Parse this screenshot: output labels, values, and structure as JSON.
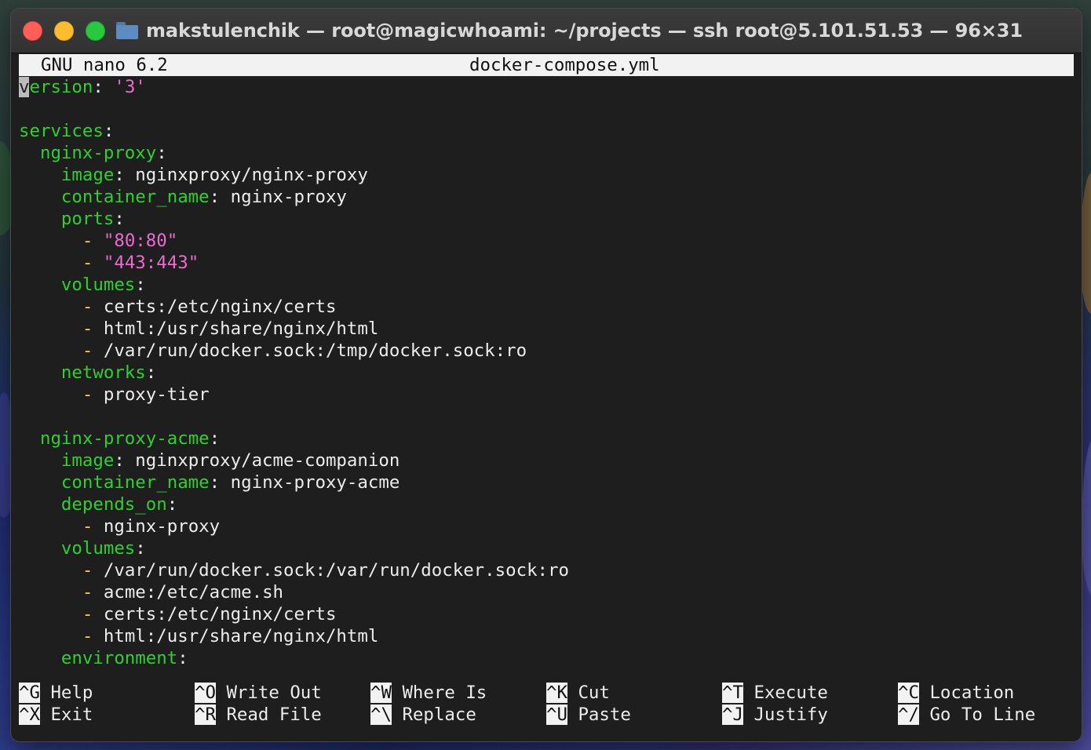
{
  "window": {
    "title": "makstulenchik — root@magicwhoami: ~/projects — ssh root@5.101.51.53 — 96×31"
  },
  "editor": {
    "app_version": "GNU nano 6.2",
    "filename": "docker-compose.yml"
  },
  "yaml_lines": [
    [
      {
        "t": "cursor",
        "v": "v"
      },
      {
        "t": "key",
        "v": "ersion"
      },
      {
        "t": "punct",
        "v": ": "
      },
      {
        "t": "str",
        "v": "'3'"
      }
    ],
    [],
    [
      {
        "t": "key",
        "v": "services"
      },
      {
        "t": "punct",
        "v": ":"
      }
    ],
    [
      {
        "t": "sp",
        "v": "  "
      },
      {
        "t": "key",
        "v": "nginx-proxy"
      },
      {
        "t": "punct",
        "v": ":"
      }
    ],
    [
      {
        "t": "sp",
        "v": "    "
      },
      {
        "t": "key",
        "v": "image"
      },
      {
        "t": "punct",
        "v": ": "
      },
      {
        "t": "val",
        "v": "nginxproxy/nginx-proxy"
      }
    ],
    [
      {
        "t": "sp",
        "v": "    "
      },
      {
        "t": "key",
        "v": "container_name"
      },
      {
        "t": "punct",
        "v": ": "
      },
      {
        "t": "val",
        "v": "nginx-proxy"
      }
    ],
    [
      {
        "t": "sp",
        "v": "    "
      },
      {
        "t": "key",
        "v": "ports"
      },
      {
        "t": "punct",
        "v": ":"
      }
    ],
    [
      {
        "t": "sp",
        "v": "      "
      },
      {
        "t": "dash",
        "v": "- "
      },
      {
        "t": "str",
        "v": "\"80:80\""
      }
    ],
    [
      {
        "t": "sp",
        "v": "      "
      },
      {
        "t": "dash",
        "v": "- "
      },
      {
        "t": "str",
        "v": "\"443:443\""
      }
    ],
    [
      {
        "t": "sp",
        "v": "    "
      },
      {
        "t": "key",
        "v": "volumes"
      },
      {
        "t": "punct",
        "v": ":"
      }
    ],
    [
      {
        "t": "sp",
        "v": "      "
      },
      {
        "t": "dash",
        "v": "- "
      },
      {
        "t": "val",
        "v": "certs:/etc/nginx/certs"
      }
    ],
    [
      {
        "t": "sp",
        "v": "      "
      },
      {
        "t": "dash",
        "v": "- "
      },
      {
        "t": "val",
        "v": "html:/usr/share/nginx/html"
      }
    ],
    [
      {
        "t": "sp",
        "v": "      "
      },
      {
        "t": "dash",
        "v": "- "
      },
      {
        "t": "val",
        "v": "/var/run/docker.sock:/tmp/docker.sock:ro"
      }
    ],
    [
      {
        "t": "sp",
        "v": "    "
      },
      {
        "t": "key",
        "v": "networks"
      },
      {
        "t": "punct",
        "v": ":"
      }
    ],
    [
      {
        "t": "sp",
        "v": "      "
      },
      {
        "t": "dash",
        "v": "- "
      },
      {
        "t": "val",
        "v": "proxy-tier"
      }
    ],
    [],
    [
      {
        "t": "sp",
        "v": "  "
      },
      {
        "t": "key",
        "v": "nginx-proxy-acme"
      },
      {
        "t": "punct",
        "v": ":"
      }
    ],
    [
      {
        "t": "sp",
        "v": "    "
      },
      {
        "t": "key",
        "v": "image"
      },
      {
        "t": "punct",
        "v": ": "
      },
      {
        "t": "val",
        "v": "nginxproxy/acme-companion"
      }
    ],
    [
      {
        "t": "sp",
        "v": "    "
      },
      {
        "t": "key",
        "v": "container_name"
      },
      {
        "t": "punct",
        "v": ": "
      },
      {
        "t": "val",
        "v": "nginx-proxy-acme"
      }
    ],
    [
      {
        "t": "sp",
        "v": "    "
      },
      {
        "t": "key",
        "v": "depends_on"
      },
      {
        "t": "punct",
        "v": ":"
      }
    ],
    [
      {
        "t": "sp",
        "v": "      "
      },
      {
        "t": "dash",
        "v": "- "
      },
      {
        "t": "val",
        "v": "nginx-proxy"
      }
    ],
    [
      {
        "t": "sp",
        "v": "    "
      },
      {
        "t": "key",
        "v": "volumes"
      },
      {
        "t": "punct",
        "v": ":"
      }
    ],
    [
      {
        "t": "sp",
        "v": "      "
      },
      {
        "t": "dash",
        "v": "- "
      },
      {
        "t": "val",
        "v": "/var/run/docker.sock:/var/run/docker.sock:ro"
      }
    ],
    [
      {
        "t": "sp",
        "v": "      "
      },
      {
        "t": "dash",
        "v": "- "
      },
      {
        "t": "val",
        "v": "acme:/etc/acme.sh"
      }
    ],
    [
      {
        "t": "sp",
        "v": "      "
      },
      {
        "t": "dash",
        "v": "- "
      },
      {
        "t": "val",
        "v": "certs:/etc/nginx/certs"
      }
    ],
    [
      {
        "t": "sp",
        "v": "      "
      },
      {
        "t": "dash",
        "v": "- "
      },
      {
        "t": "val",
        "v": "html:/usr/share/nginx/html"
      }
    ],
    [
      {
        "t": "sp",
        "v": "    "
      },
      {
        "t": "key",
        "v": "environment"
      },
      {
        "t": "punct",
        "v": ":"
      }
    ]
  ],
  "shortcuts": [
    [
      {
        "key": "^G",
        "label": "Help"
      },
      {
        "key": "^O",
        "label": "Write Out"
      },
      {
        "key": "^W",
        "label": "Where Is"
      },
      {
        "key": "^K",
        "label": "Cut"
      },
      {
        "key": "^T",
        "label": "Execute"
      },
      {
        "key": "^C",
        "label": "Location"
      }
    ],
    [
      {
        "key": "^X",
        "label": "Exit"
      },
      {
        "key": "^R",
        "label": "Read File"
      },
      {
        "key": "^\\",
        "label": "Replace"
      },
      {
        "key": "^U",
        "label": "Paste"
      },
      {
        "key": "^J",
        "label": "Justify"
      },
      {
        "key": "^/",
        "label": "Go To Line"
      }
    ]
  ],
  "colors": {
    "key": "#2fd02f",
    "string": "#ec6ad0",
    "dash": "#f0d23c",
    "text": "#ececec",
    "background": "#1e1e1e",
    "header_bg": "#f2f2f2"
  }
}
